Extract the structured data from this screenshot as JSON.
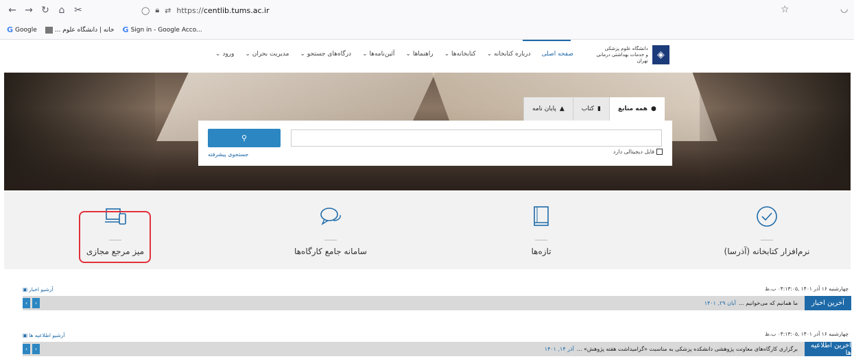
{
  "browser": {
    "url_prefix": "https://",
    "url_host": "centlib.tums.ac.ir",
    "bookmarks": [
      {
        "label": "Google",
        "icon": "google-icon"
      },
      {
        "label": "خانه | دانشگاه علوم ...",
        "icon": "site-icon"
      },
      {
        "label": "Sign in - Google Acco...",
        "icon": "google-icon"
      }
    ]
  },
  "site": {
    "logo_text_1": "دانشگاه علوم پزشکی",
    "logo_text_2": "و خدمات بهداشتی درمانی تهران",
    "menu": [
      "صفحه اصلی",
      "درباره کتابخانه ⌄",
      "کتابخانه‌ها ⌄",
      "راهنماها ⌄",
      "آئین‌نامه‌ها ⌄",
      "درگاه‌های جستجو ⌄",
      "مدیریت بحران ⌄",
      "ورود ⌄"
    ]
  },
  "search": {
    "tabs": [
      "همه منابع",
      "کتاب",
      "پایان نامه"
    ],
    "placeholder": "",
    "button_icon": "search-icon",
    "advanced_label": "جستجوی پیشرفته",
    "digital_label": "فایل دیجیتالی دارد"
  },
  "features": [
    {
      "label": "نرم‌افزار کتابخانه (آذرسا)",
      "icon": "check-circle-icon"
    },
    {
      "label": "تازه‌ها",
      "icon": "book-icon"
    },
    {
      "label": "سامانه جامع کارگاه‌ها",
      "icon": "chat-icon"
    },
    {
      "label": "میز مرجع مجازی",
      "icon": "devices-icon"
    }
  ],
  "news": {
    "date": "چهارشنبه ۱۶ آذر ۱۴۰۱ ,۰۴:۱۳:۰۵ ب.ظ",
    "archive_label": "آرشیو اخبار",
    "label": "آخرین اخبار",
    "item_text": "ما همانیم که می‌خوانیم ...",
    "item_date": "آبان ۲۹, ۱۴۰۱"
  },
  "announcements": {
    "date": "چهارشنبه ۱۶ آذر ۱۴۰۱ ,۰۴:۱۳:۰۵ ب.ظ",
    "archive_label": "آرشیو اطلاعیه ها",
    "label": "آخرین اطلاعیه ها",
    "item_text": "برگزاری کارگاه‌های معاونت پژوهشی دانشکده پزشکی به مناسبت «گرامیداشت هفته پژوهش» ...",
    "item_date": "آذر ۱۴, ۱۴۰۱"
  },
  "colors": {
    "accent": "#1e6aa8",
    "button": "#2b86c1",
    "highlight": "#e0303a"
  }
}
